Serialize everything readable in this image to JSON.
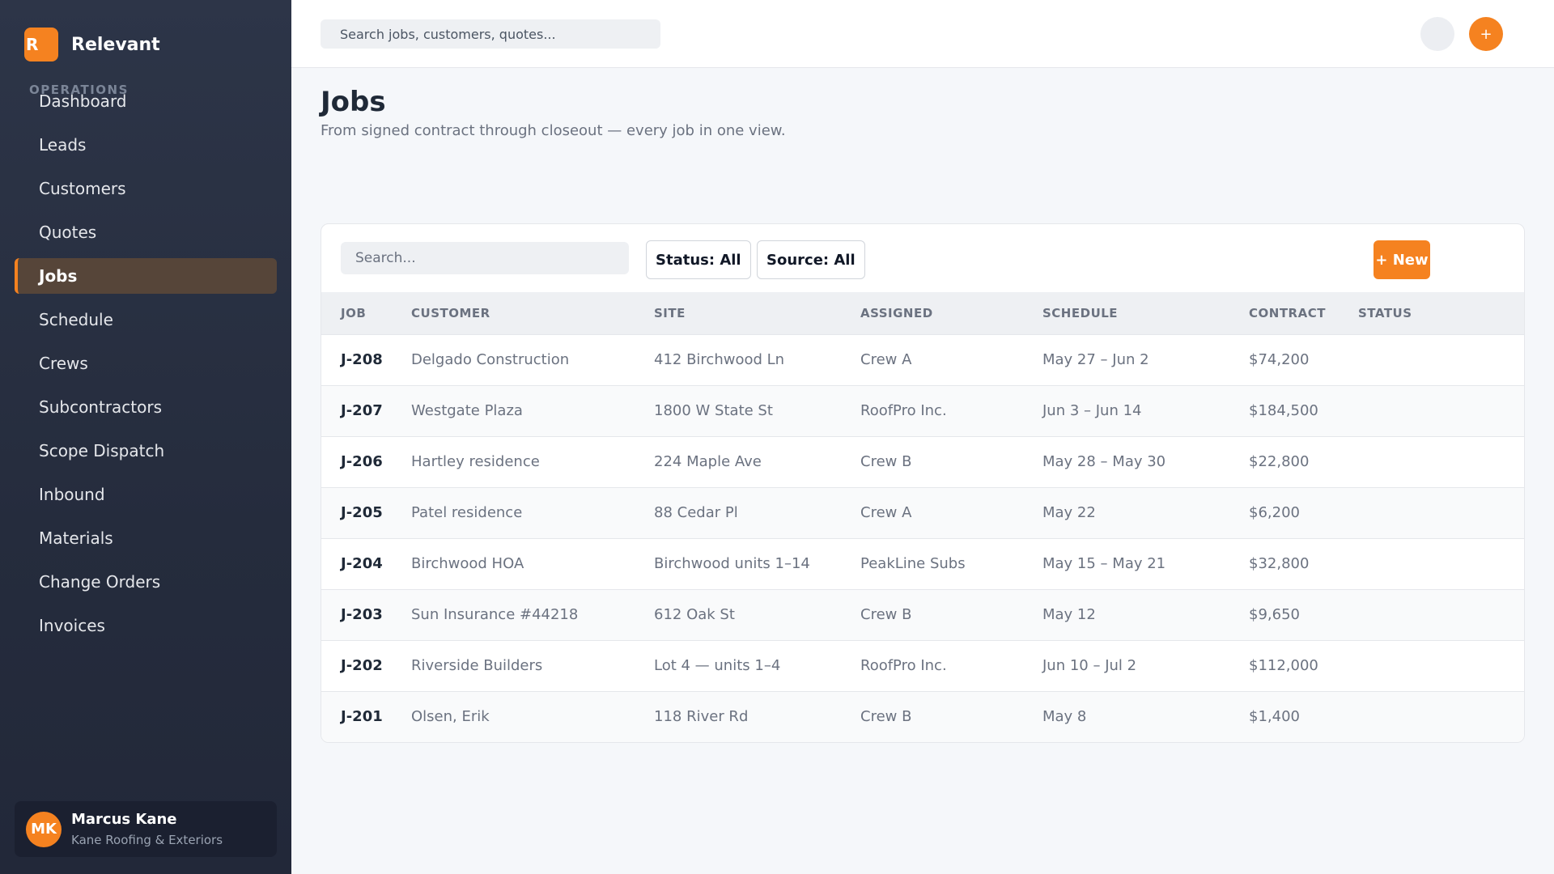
{
  "brand": {
    "logo_letter": "R",
    "name": "Relevant"
  },
  "sidebar": {
    "section_label": "OPERATIONS",
    "items": [
      {
        "label": "Dashboard"
      },
      {
        "label": "Leads"
      },
      {
        "label": "Customers"
      },
      {
        "label": "Quotes"
      },
      {
        "label": "Jobs",
        "active": true
      },
      {
        "label": "Schedule"
      },
      {
        "label": "Crews"
      },
      {
        "label": "Subcontractors"
      },
      {
        "label": "Scope Dispatch"
      },
      {
        "label": "Inbound"
      },
      {
        "label": "Materials"
      },
      {
        "label": "Change Orders"
      },
      {
        "label": "Invoices"
      }
    ]
  },
  "user": {
    "initials": "MK",
    "name": "Marcus Kane",
    "company": "Kane Roofing & Exteriors"
  },
  "topbar": {
    "search_placeholder": "Search jobs, customers, quotes...",
    "add_label": "+"
  },
  "page": {
    "title": "Jobs",
    "subtitle": "From signed contract through closeout — every job in one view."
  },
  "toolbar": {
    "search_placeholder": "Search...",
    "status_filter": "Status: All",
    "source_filter": "Source: All",
    "new_label": "+ New"
  },
  "table": {
    "columns": [
      "JOB",
      "CUSTOMER",
      "SITE",
      "ASSIGNED",
      "SCHEDULE",
      "CONTRACT",
      "STATUS"
    ],
    "rows": [
      {
        "job": "J-208",
        "customer": "Delgado Construction",
        "site": "412 Birchwood Ln",
        "assigned": "Crew A",
        "schedule": "May 27 – Jun 2",
        "contract": "$74,200",
        "status": ""
      },
      {
        "job": "J-207",
        "customer": "Westgate Plaza",
        "site": "1800 W State St",
        "assigned": "RoofPro Inc.",
        "schedule": "Jun 3 – Jun 14",
        "contract": "$184,500",
        "status": ""
      },
      {
        "job": "J-206",
        "customer": "Hartley residence",
        "site": "224 Maple Ave",
        "assigned": "Crew B",
        "schedule": "May 28 – May 30",
        "contract": "$22,800",
        "status": ""
      },
      {
        "job": "J-205",
        "customer": "Patel residence",
        "site": "88 Cedar Pl",
        "assigned": "Crew A",
        "schedule": "May 22",
        "contract": "$6,200",
        "status": ""
      },
      {
        "job": "J-204",
        "customer": "Birchwood HOA",
        "site": "Birchwood units 1–14",
        "assigned": "PeakLine Subs",
        "schedule": "May 15 – May 21",
        "contract": "$32,800",
        "status": ""
      },
      {
        "job": "J-203",
        "customer": "Sun Insurance #44218",
        "site": "612 Oak St",
        "assigned": "Crew B",
        "schedule": "May 12",
        "contract": "$9,650",
        "status": ""
      },
      {
        "job": "J-202",
        "customer": "Riverside Builders",
        "site": "Lot 4 — units 1–4",
        "assigned": "RoofPro Inc.",
        "schedule": "Jun 10 – Jul 2",
        "contract": "$112,000",
        "status": ""
      },
      {
        "job": "J-201",
        "customer": "Olsen, Erik",
        "site": "118 River Rd",
        "assigned": "Crew B",
        "schedule": "May 8",
        "contract": "$1,400",
        "status": ""
      }
    ]
  },
  "colors": {
    "accent": "#f58220",
    "sidebar_bg": "#2d3548",
    "active_item_bg": "#564539"
  }
}
